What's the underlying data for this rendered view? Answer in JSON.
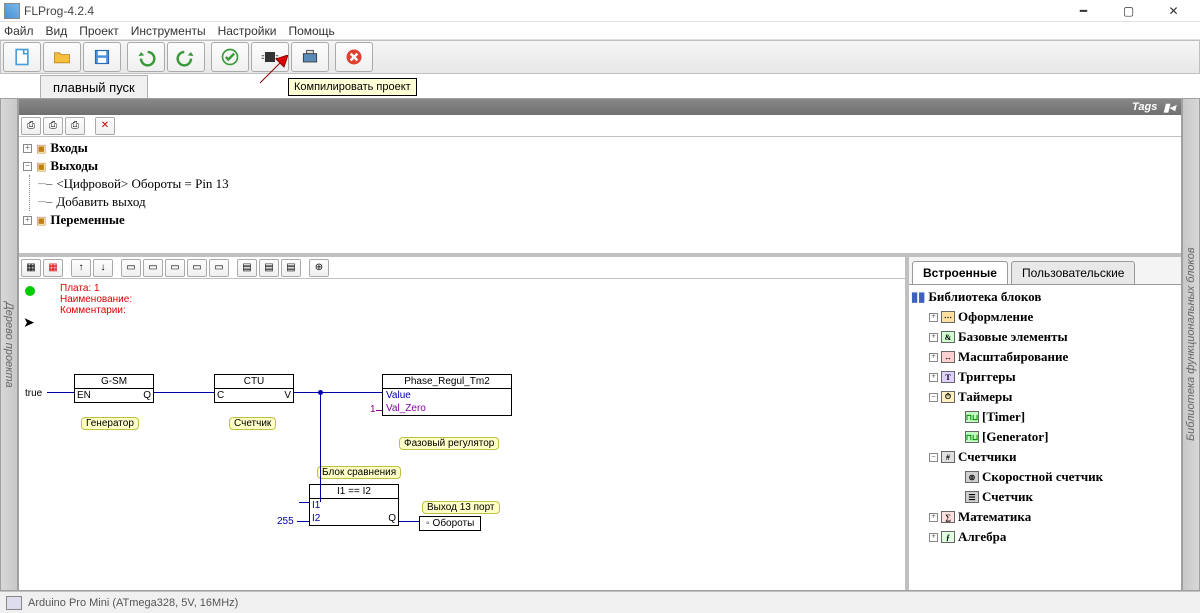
{
  "window": {
    "title": "FLProg-4.2.4"
  },
  "menu": {
    "items": [
      "Файл",
      "Вид",
      "Проект",
      "Инструменты",
      "Настройки",
      "Помощь"
    ]
  },
  "project_tab": "плавный пуск",
  "tooltip": "Компилировать проект",
  "tags_label": "Tags",
  "sidebar_left": "Дерево проекта",
  "sidebar_right": "Библиотека функциональных блоков",
  "tree": {
    "n0": "Входы",
    "n1": "Выходы",
    "n1_0": "<Цифровой> Обороты  = Pin 13",
    "n1_1": "Добавить выход",
    "n2": "Переменные"
  },
  "canvas": {
    "board_lbl": "Плата: 1",
    "name_lbl": "Наименование:",
    "comm_lbl": "Комментарии:",
    "true_lbl": "true",
    "gsm_title": "G-SM",
    "gsm_en": "EN",
    "gsm_q": "Q",
    "gen_lbl": "Генератор",
    "ctu_title": "CTU",
    "ctu_c": "C",
    "ctu_v": "V",
    "ctr_lbl": "Счетчик",
    "pr_title": "Phase_Regul_Tm2",
    "pr_value": "Value",
    "pr_valzero": "Val_Zero",
    "pr_one": "1",
    "phase_lbl": "Фазовый регулятор",
    "cmp_lbl": "Блок сравнения",
    "cmp_title": "I1 == I2",
    "cmp_i1": "I1",
    "cmp_i2": "I2",
    "cmp_q": "Q",
    "n255": "255",
    "out13_lbl": "Выход 13 порт",
    "rpm_lbl": "Обороты"
  },
  "library": {
    "tab1": "Встроенные",
    "tab2": "Пользовательские",
    "root": "Библиотека блоков",
    "n0": "Оформление",
    "n1": "Базовые элементы",
    "n2": "Масштабирование",
    "n3": "Триггеры",
    "n4": "Таймеры",
    "n4_0": "[Timer]",
    "n4_1": "[Generator]",
    "n5": "Счетчики",
    "n5_0": "Скоростной счетчик",
    "n5_1": "Счетчик",
    "n6": "Математика",
    "n7": "Алгебра"
  },
  "status": "Arduino Pro Mini (ATmega328, 5V, 16MHz)"
}
